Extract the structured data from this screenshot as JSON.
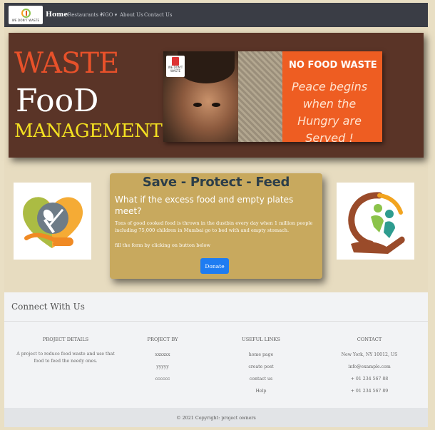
{
  "navbar": {
    "brand_text": "WE DON'T WASTE",
    "home": "Home",
    "restaurants": "Restaurants",
    "ngo": "NGO",
    "about": "About Us",
    "contact": "Contact Us"
  },
  "hero": {
    "line1": "WASTE",
    "line2": "FooD",
    "line3": "MANAGEMENT",
    "banner_bin_text": "WE DON'T WASTE",
    "banner_title": "NO FOOD WASTE",
    "banner_quote": "Peace begins when the Hungry are Served !"
  },
  "card": {
    "title": "Save - Protect - Feed",
    "question": "What if the excess food and empty plates meet?",
    "body": "Tons of good cooked food is thrown in the dustbin every day when 1 million people including 75,000 children in Mumbai go to bed with and empty stomach.",
    "note": "fill the form by clicking on button below",
    "donate_label": "Donate"
  },
  "footer": {
    "heading": "Connect With Us",
    "project_details": {
      "title": "PROJECT DETAILS",
      "text": "A project to reduce food waste and use that food to feed the needy ones."
    },
    "project_by": {
      "title": "PROJECT BY",
      "items": [
        "xxxxxx",
        "yyyyy",
        "cccccc"
      ]
    },
    "useful_links": {
      "title": "USEFUL LINKS",
      "items": [
        "home page",
        "create post",
        "contact us",
        "Help"
      ]
    },
    "contact": {
      "title": "CONTACT",
      "items": [
        "New York, NY 10012, US",
        "info@example.com",
        "+ 01 234 567 88",
        "+ 01 234 567 89"
      ]
    },
    "copyright": "© 2021 Copyright: project owners"
  },
  "colors": {
    "navbar": "#3a3d45",
    "hero_bg": "#5a3427",
    "card_bg": "#c8a95e",
    "donate_button": "#1e7cf2"
  }
}
